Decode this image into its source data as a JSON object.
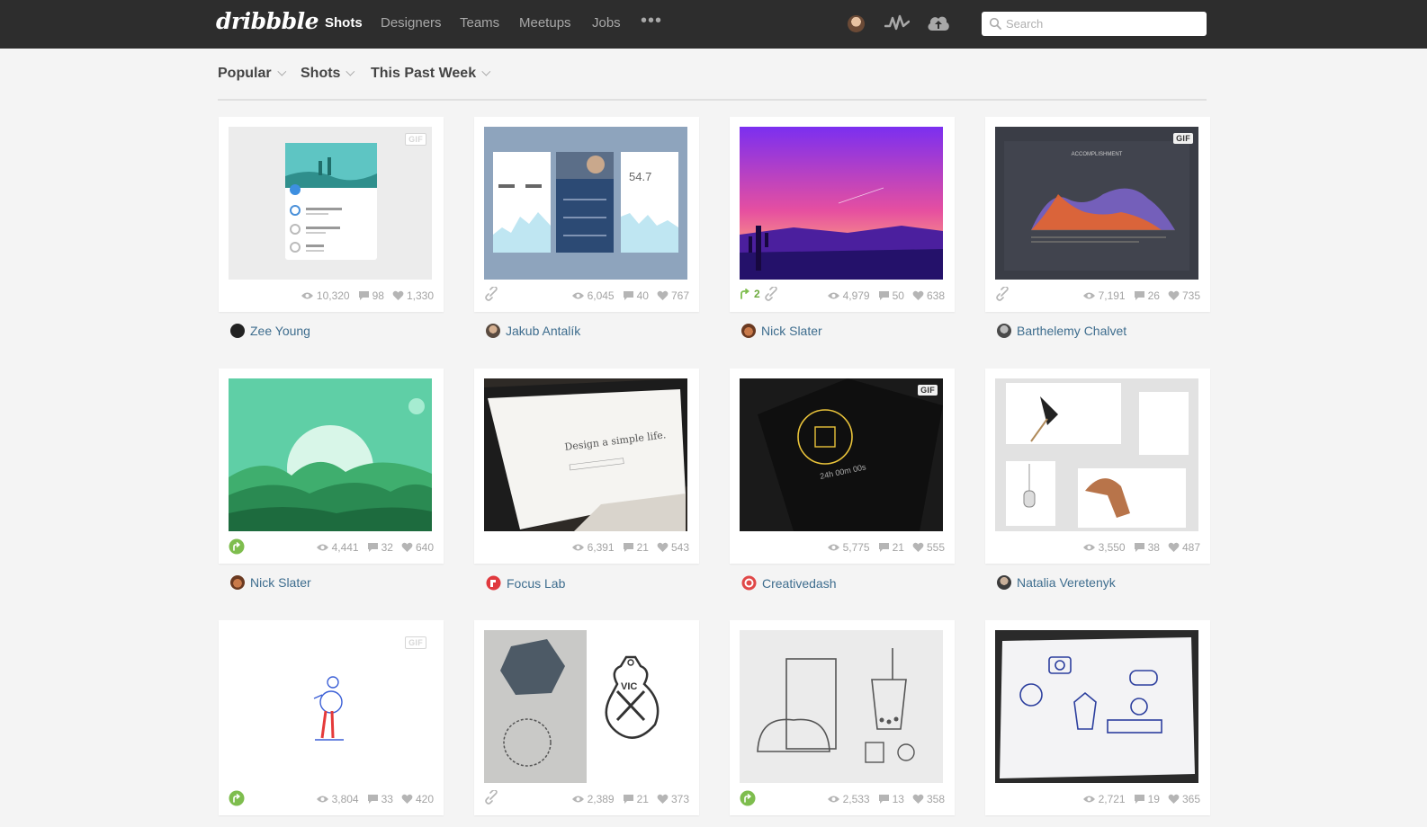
{
  "header": {
    "logo": "dribbble",
    "nav": [
      {
        "label": "Shots",
        "active": true
      },
      {
        "label": "Designers"
      },
      {
        "label": "Teams"
      },
      {
        "label": "Meetups"
      },
      {
        "label": "Jobs"
      }
    ],
    "more": "•••",
    "search_placeholder": "Search",
    "icons": [
      "avatar",
      "activity-icon",
      "upload-icon",
      "search-icon"
    ]
  },
  "filters": [
    {
      "label": "Popular"
    },
    {
      "label": "Shots"
    },
    {
      "label": "This Past Week"
    }
  ],
  "colors": {
    "topbar": "#2d2d2d",
    "link": "#3e6d8e",
    "rebound": "#7ebd4e",
    "stat": "#a3a3a3"
  },
  "shots": [
    {
      "views": "10,320",
      "comments": "98",
      "likes": "1,330",
      "author": "Zee Young",
      "gif": "GIF",
      "thumb_icon": "app-list-mockup"
    },
    {
      "views": "6,045",
      "comments": "40",
      "likes": "767",
      "author": "Jakub Antalík",
      "attachment": true,
      "thumb_icon": "dashboard-cards",
      "thumb_text": "54.7"
    },
    {
      "views": "4,979",
      "comments": "50",
      "likes": "638",
      "author": "Nick Slater",
      "rebounds": "2",
      "attachment": true,
      "thumb_icon": "purple-desert-sunset"
    },
    {
      "views": "7,191",
      "comments": "26",
      "likes": "735",
      "author": "Barthelemy Chalvet",
      "gif": "GIF",
      "attachment": true,
      "thumb_icon": "area-chart-dark",
      "thumb_text": "ACCOMPLISHMENT"
    },
    {
      "views": "4,441",
      "comments": "32",
      "likes": "640",
      "author": "Nick Slater",
      "rebound_icon": true,
      "thumb_icon": "green-mountains"
    },
    {
      "views": "6,391",
      "comments": "21",
      "likes": "543",
      "author": "Focus Lab",
      "thumb_icon": "laptop-website",
      "thumb_text": "Design a simple life."
    },
    {
      "views": "5,775",
      "comments": "21",
      "likes": "555",
      "author": "Creativedash",
      "gif": "GIF",
      "thumb_icon": "dark-phone-timer",
      "thumb_text": "24h 00m 00s"
    },
    {
      "views": "3,550",
      "comments": "38",
      "likes": "487",
      "author": "Natalia Veretenyk",
      "thumb_icon": "lamp-chair-collage"
    },
    {
      "views": "3,804",
      "comments": "33",
      "likes": "420",
      "author": "",
      "gif": "GIF",
      "rebound_icon": true,
      "thumb_icon": "skater-figure"
    },
    {
      "views": "2,389",
      "comments": "21",
      "likes": "373",
      "author": "",
      "attachment": true,
      "thumb_icon": "vic-stamp",
      "thumb_text": "VIC"
    },
    {
      "views": "2,533",
      "comments": "13",
      "likes": "358",
      "author": "",
      "rebound_icon": true,
      "thumb_icon": "food-line-icons"
    },
    {
      "views": "2,721",
      "comments": "19",
      "likes": "365",
      "author": "",
      "thumb_icon": "line-icons-on-monitor"
    }
  ]
}
